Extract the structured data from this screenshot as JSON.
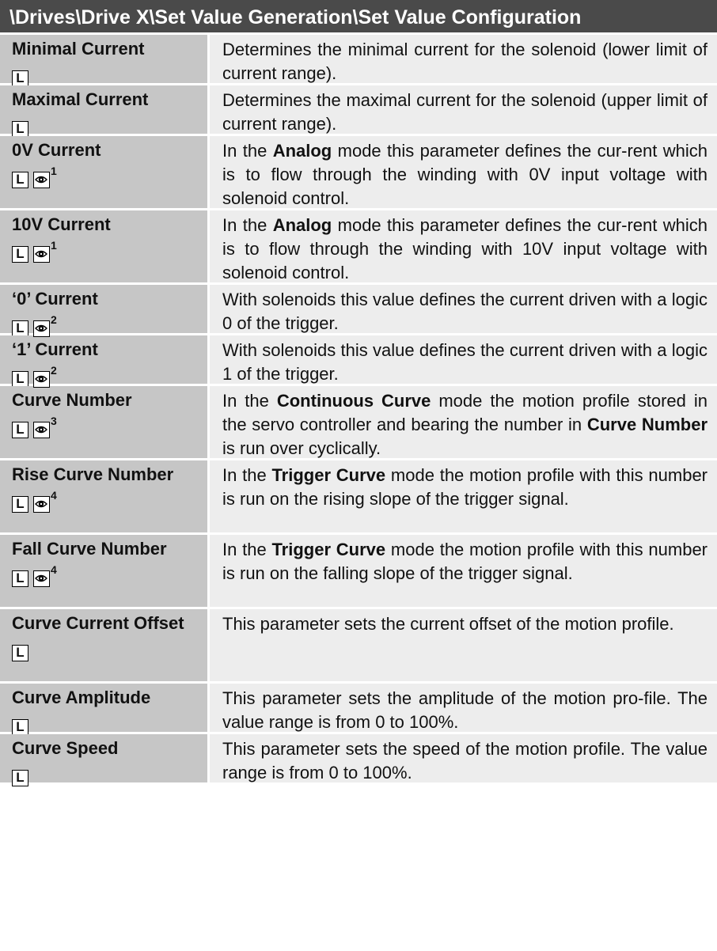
{
  "header": {
    "title": "\\Drives\\Drive X\\Set Value Generation\\Set Value Configuration"
  },
  "icons": {
    "l_badge": "L",
    "eye": "eye-icon"
  },
  "rows": [
    {
      "name": "Minimal Current",
      "eye": false,
      "sup": "",
      "desc_parts": [
        "Determines the minimal current for the solenoid (lower limit of current range)."
      ]
    },
    {
      "name": "Maximal Current",
      "eye": false,
      "sup": "",
      "desc_parts": [
        "Determines the maximal current for the solenoid (upper limit of current range)."
      ]
    },
    {
      "name": "0V Current",
      "eye": true,
      "sup": "1",
      "desc_parts": [
        "In the ",
        "Analog",
        " mode this parameter defines the cur-rent which is to flow through the winding with 0V input voltage with solenoid control."
      ]
    },
    {
      "name": "10V Current",
      "eye": true,
      "sup": "1",
      "desc_parts": [
        "In the ",
        "Analog",
        " mode this parameter defines the cur-rent which is to flow through the winding with 10V input voltage with solenoid control."
      ]
    },
    {
      "name": "‘0’ Current",
      "eye": true,
      "sup": "2",
      "desc_parts": [
        "With solenoids this value defines the current driven with a logic 0 of the trigger."
      ]
    },
    {
      "name": "‘1’ Current",
      "eye": true,
      "sup": "2",
      "desc_parts": [
        "With solenoids this value defines the current driven with a logic 1 of the trigger."
      ]
    },
    {
      "name": "Curve Number",
      "eye": true,
      "sup": "3",
      "desc_parts": [
        "In the ",
        "Continuous Curve",
        " mode the motion profile stored in the servo controller and bearing the number in ",
        "Curve Number",
        " is run over cyclically."
      ]
    },
    {
      "name": "Rise Curve Number",
      "eye": true,
      "sup": "4",
      "desc_parts": [
        "In the ",
        "Trigger Curve",
        " mode the motion profile with this number is run on the rising slope of the trigger signal."
      ]
    },
    {
      "name": "Fall Curve Number",
      "eye": true,
      "sup": "4",
      "desc_parts": [
        "In the ",
        "Trigger Curve",
        " mode the motion profile with this number is run on the falling slope of the trigger signal."
      ]
    },
    {
      "name": "Curve Current Offset",
      "eye": false,
      "sup": "",
      "desc_parts": [
        "This parameter sets the current offset of the motion profile."
      ]
    },
    {
      "name": "Curve Amplitude",
      "eye": false,
      "sup": "",
      "desc_parts": [
        "This parameter sets the amplitude of the motion pro-file. The value range is from 0 to 100%."
      ]
    },
    {
      "name": "Curve Speed",
      "eye": false,
      "sup": "",
      "desc_parts": [
        "This parameter sets the speed of the motion profile. The value range is from 0 to 100%."
      ]
    }
  ]
}
